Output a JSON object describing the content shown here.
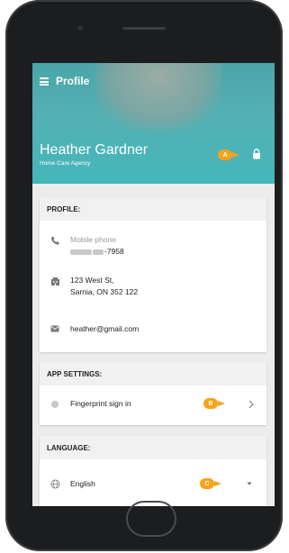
{
  "header": {
    "title": "Profile"
  },
  "user": {
    "name": "Heather Gardner",
    "organization": "Home Care Agency"
  },
  "markers": {
    "a": "A",
    "b": "B",
    "c": "C"
  },
  "profile": {
    "section_title": "PROFILE:",
    "phone_label": "Mobile phone",
    "phone_value_suffix": "-7958",
    "address_line1": "123 West St,",
    "address_line2": "Sarnia, ON 352 122",
    "email": "heather@gmail.com"
  },
  "app_settings": {
    "section_title": "APP SETTINGS:",
    "fingerprint_label": "Fingerprint sign in"
  },
  "language": {
    "section_title": "LANGUAGE:",
    "selected": "English"
  },
  "colors": {
    "accent_teal": "#45b7bb",
    "marker_orange": "#f6a41c"
  },
  "icons": [
    "menu-icon",
    "lock-icon",
    "phone-icon",
    "building-icon",
    "email-icon",
    "fingerprint-icon",
    "chevron-right-icon",
    "globe-icon",
    "chevron-down-icon"
  ]
}
